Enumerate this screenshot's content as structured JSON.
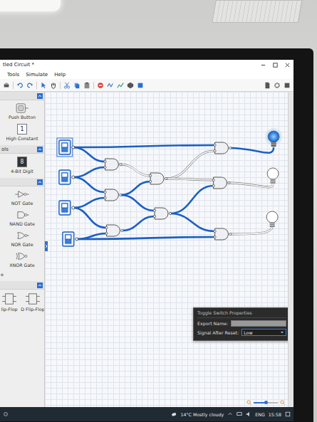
{
  "window": {
    "title": "tled Circuit *"
  },
  "menu": [
    "Tools",
    "Simulate",
    "Help"
  ],
  "palette": [
    {
      "items": [
        {
          "label": "Push Button",
          "kind": "push-button"
        },
        {
          "label": "High Constant",
          "kind": "high-constant",
          "glyph": "1"
        }
      ]
    },
    {
      "title": "ols",
      "items": [
        {
          "label": "4-Bit Digit",
          "kind": "digit",
          "glyph": "8"
        }
      ]
    },
    {
      "items": [
        {
          "label": "NOT Gate",
          "kind": "not"
        },
        {
          "label": "NAND Gate",
          "kind": "nand"
        },
        {
          "label": "NOR Gate",
          "kind": "nor"
        },
        {
          "label": "XNOR Gate",
          "kind": "xnor"
        },
        {
          "label": "e",
          "kind": "cut"
        }
      ]
    },
    {
      "items": [
        {
          "label": "lip-Flop",
          "kind": "flipflop"
        },
        {
          "label": "D Flip-Flop",
          "kind": "flipflop"
        }
      ]
    }
  ],
  "circuit": {
    "switches": [
      {
        "on": true,
        "selected": true
      },
      {
        "on": true,
        "selected": false
      },
      {
        "on": true,
        "selected": false
      },
      {
        "on": true,
        "selected": false
      }
    ],
    "gates": [
      {
        "kind": "and"
      },
      {
        "kind": "and"
      },
      {
        "kind": "and"
      },
      {
        "kind": "and"
      },
      {
        "kind": "and"
      },
      {
        "kind": "and"
      },
      {
        "kind": "and"
      },
      {
        "kind": "and"
      }
    ],
    "wires": [
      {
        "high": true
      },
      {
        "high": true
      },
      {
        "high": true
      },
      {
        "high": true
      },
      {
        "high": true
      },
      {
        "high": true
      },
      {
        "high": true
      },
      {
        "high": true
      },
      {
        "high": false
      },
      {
        "high": true
      },
      {
        "high": false
      },
      {
        "high": false
      },
      {
        "high": true
      },
      {
        "high": true
      },
      {
        "high": true
      },
      {
        "high": true
      },
      {
        "high": true
      },
      {
        "high": false
      },
      {
        "high": false
      }
    ],
    "bulbs": [
      {
        "lit": true
      },
      {
        "lit": false
      },
      {
        "lit": false
      }
    ]
  },
  "properties": {
    "title": "Toggle Switch Properties",
    "export_label": "Export Name:",
    "export_value": "",
    "reset_label": "Signal After Reset:",
    "reset_value": "Low"
  },
  "zoom": {
    "level": 0.5
  },
  "taskbar": {
    "weather": "14°C Mostly cloudy",
    "language": "ENG",
    "time": "15:58"
  }
}
